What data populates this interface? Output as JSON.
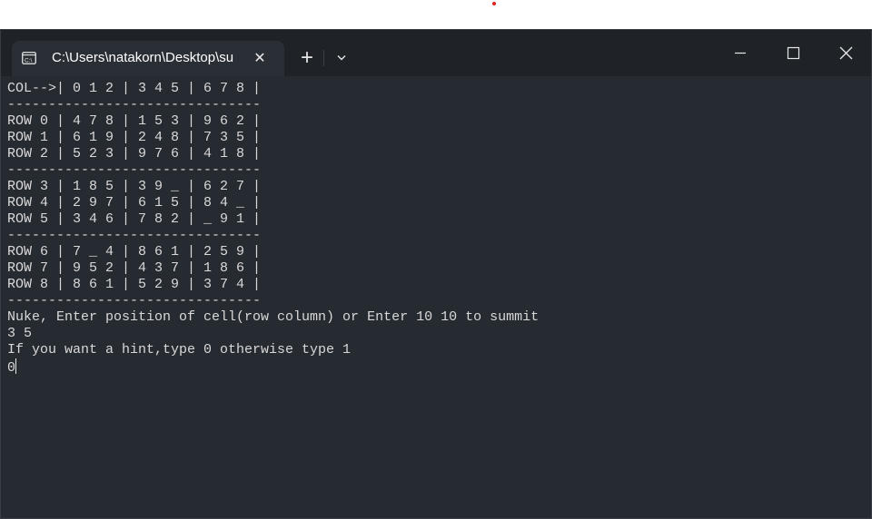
{
  "window": {
    "tab_title": "C:\\Users\\natakorn\\Desktop\\su",
    "tab_icon": "terminal-icon",
    "new_tab_symbol": "+",
    "close_tab_symbol": "✕",
    "controls": [
      "minimize-icon",
      "maximize-icon",
      "close-icon"
    ]
  },
  "terminal": {
    "lines": [
      "COL-->| 0 1 2 | 3 4 5 | 6 7 8 |",
      "-------------------------------",
      "ROW 0 | 4 7 8 | 1 5 3 | 9 6 2 |",
      "ROW 1 | 6 1 9 | 2 4 8 | 7 3 5 |",
      "ROW 2 | 5 2 3 | 9 7 6 | 4 1 8 |",
      "-------------------------------",
      "ROW 3 | 1 8 5 | 3 9 _ | 6 2 7 |",
      "ROW 4 | 2 9 7 | 6 1 5 | 8 4 _ |",
      "ROW 5 | 3 4 6 | 7 8 2 | _ 9 1 |",
      "-------------------------------",
      "ROW 6 | 7 _ 4 | 8 6 1 | 2 5 9 |",
      "ROW 7 | 9 5 2 | 4 3 7 | 1 8 6 |",
      "ROW 8 | 8 6 1 | 5 2 9 | 3 7 4 |",
      "-------------------------------",
      "Nuke, Enter position of cell(row column) or Enter 10 10 to summit",
      "3 5",
      "If you want a hint,type 0 otherwise type 1",
      "0"
    ]
  },
  "colors": {
    "terminal_bg": "#262a31",
    "titlebar_bg": "#1f2227",
    "tab_bg": "#2a2e35",
    "text": "#d9d9d9"
  }
}
